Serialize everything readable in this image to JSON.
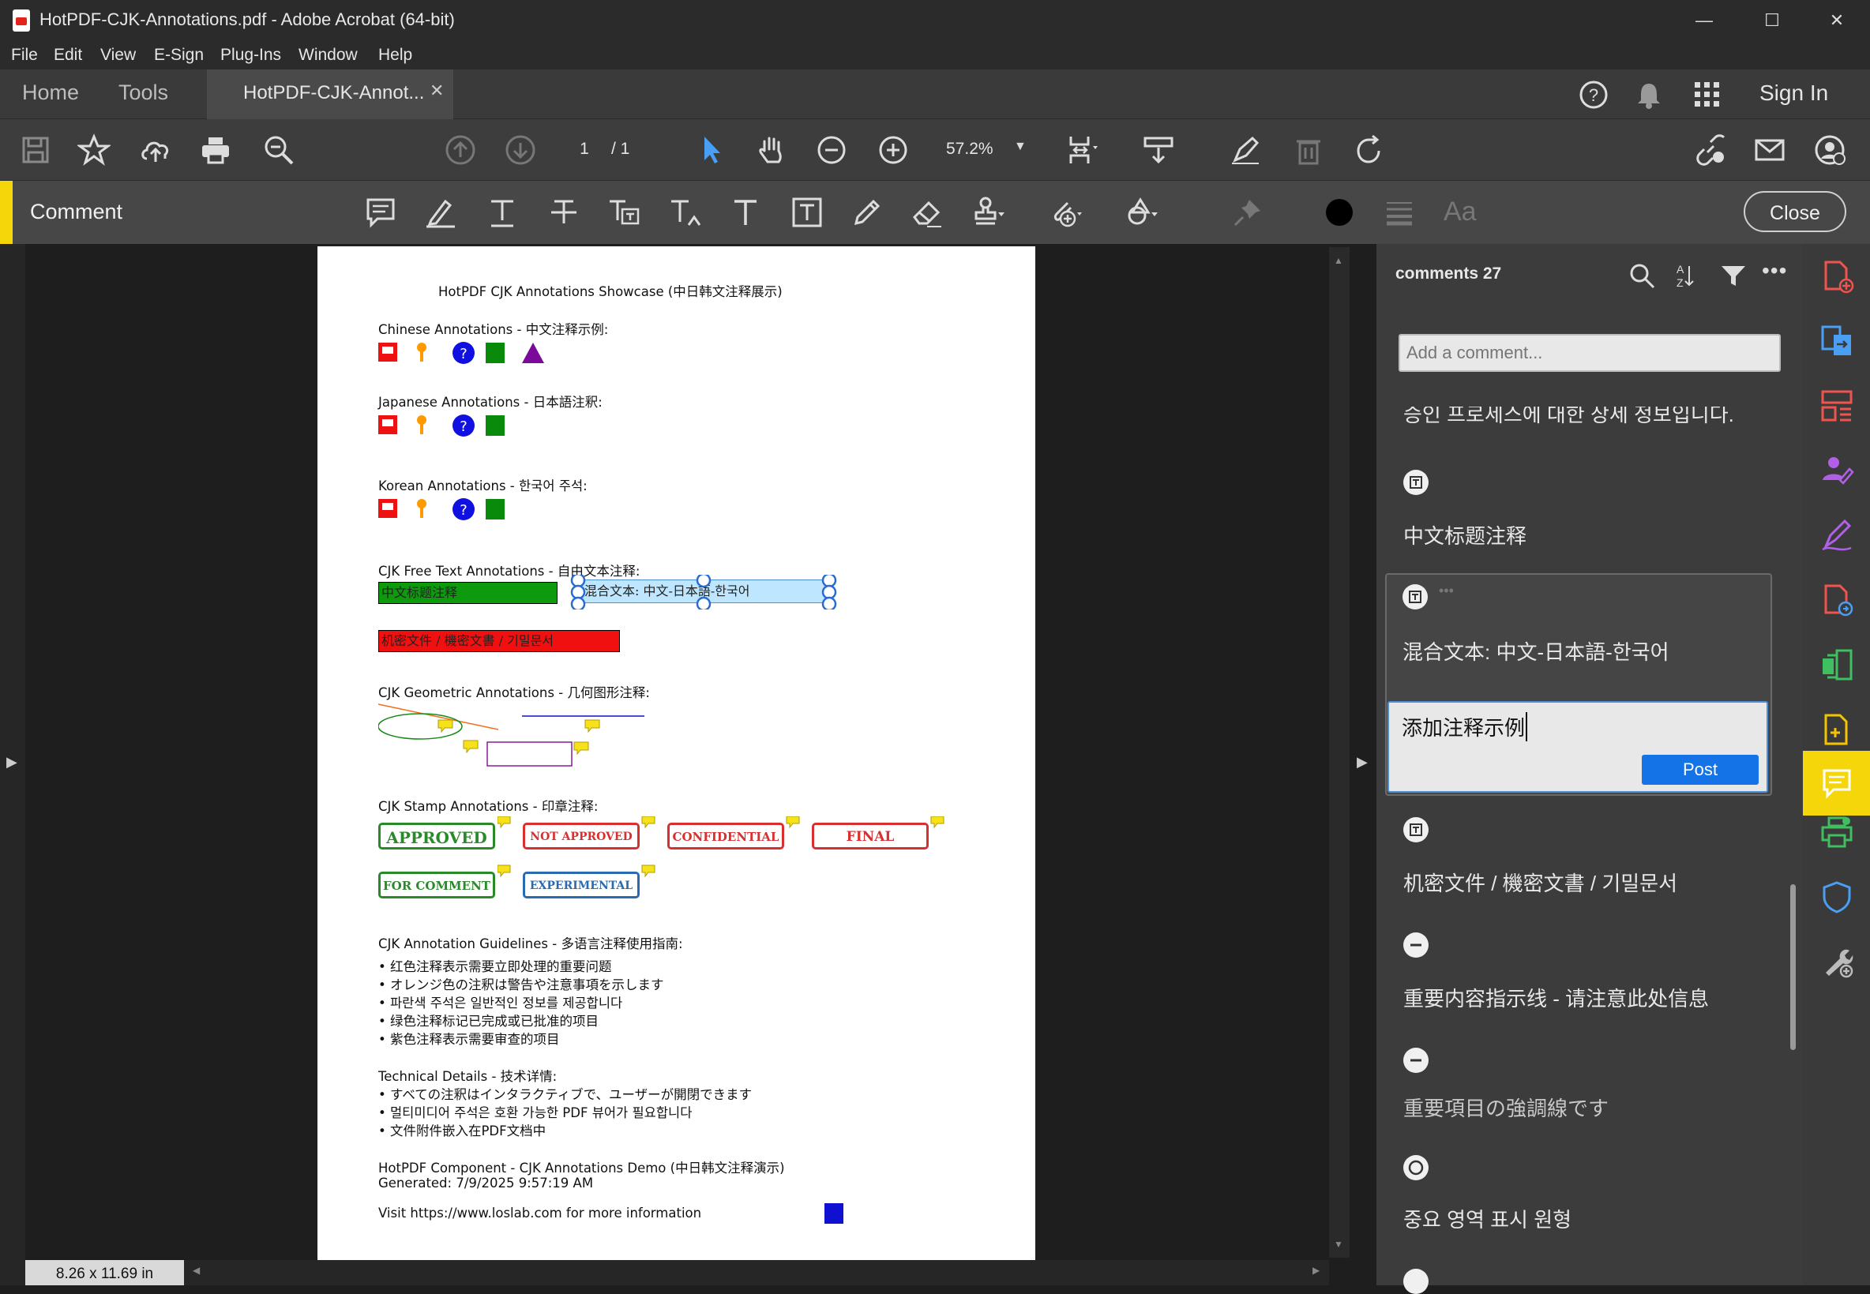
{
  "window": {
    "title": "HotPDF-CJK-Annotations.pdf - Adobe Acrobat (64-bit)"
  },
  "menu": [
    "File",
    "Edit",
    "View",
    "E-Sign",
    "Plug-Ins",
    "Window",
    "Help"
  ],
  "tabs": {
    "home": "Home",
    "tools": "Tools",
    "doc": "HotPDF-CJK-Annot...",
    "sign_in": "Sign In"
  },
  "toolbar": {
    "page_current": "1",
    "page_total": "/ 1",
    "zoom": "57.2%"
  },
  "comment_bar": {
    "title": "Comment",
    "font_btn": "Aa",
    "close": "Close"
  },
  "status": {
    "page_size": "8.26 x 11.69 in"
  },
  "document": {
    "title": "HotPDF CJK Annotations Showcase (中日韩文注释展示)",
    "chinese_heading": "Chinese Annotations - 中文注释示例:",
    "japanese_heading": "Japanese Annotations - 日本語注釈:",
    "korean_heading": "Korean Annotations - 한국어 주석:",
    "freetext_heading": "CJK Free Text Annotations - 自由文本注释:",
    "freetext_green": "中文标题注释",
    "freetext_blue": "混合文本: 中文-日本語-한국어",
    "freetext_red": "机密文件 / 機密文書 / 기밀문서",
    "geometric_heading": "CJK Geometric Annotations - 几何图形注释:",
    "stamp_heading": "CJK Stamp Annotations - 印章注释:",
    "stamps": [
      "APPROVED",
      "NOT APPROVED",
      "CONFIDENTIAL",
      "FINAL",
      "FOR COMMENT",
      "EXPERIMENTAL"
    ],
    "guidelines_heading": "CJK Annotation Guidelines - 多语言注释使用指南:",
    "guidelines": [
      "• 红色注释表示需要立即处理的重要问题",
      "• オレンジ色の注釈は警告や注意事項を示します",
      "• 파란색 주석은 일반적인 정보를 제공합니다",
      "• 绿色注释标记已完成或已批准的项目",
      "• 紫色注释表示需要审查的项目"
    ],
    "tech_heading": "Technical Details - 技术详情:",
    "tech": [
      "• すべての注釈はインタラクティブで、ユーザーが開閉できます",
      "• 멀티미디어 주석은 호환 가능한 PDF 뷰어가 필요합니다",
      "• 文件附件嵌入在PDF文档中"
    ],
    "footer1": "HotPDF Component - CJK Annotations Demo (中日韩文注释演示)",
    "footer2": "Generated: 7/9/2025 9:57:19 AM",
    "footer3": "Visit https://www.loslab.com for more information"
  },
  "comments_panel": {
    "header": "comments 27",
    "add_placeholder": "Add a comment...",
    "partial_text": "승인 프로세스에 대한 상세 정보입니다.",
    "items": [
      {
        "icon": "textbox-icon",
        "text": "中文标题注释"
      },
      {
        "icon": "textbox-icon",
        "text": "混合文本: 中文-日本語-한국어"
      },
      {
        "icon": "textbox-icon",
        "text": "机密文件 / 機密文書 / 기밀문서"
      },
      {
        "icon": "line-icon",
        "text": "重要内容指示线 - 请注意此处信息"
      },
      {
        "icon": "line-icon",
        "text": "重要項目の強調線です"
      },
      {
        "icon": "circle-icon",
        "text": "중요 영역 표시 원형"
      }
    ],
    "reply_text": "添加注释示例",
    "post": "Post"
  },
  "colors": {
    "accent": "#f5d60b",
    "post_button": "#1473e6",
    "selection": "#4a90d9"
  }
}
